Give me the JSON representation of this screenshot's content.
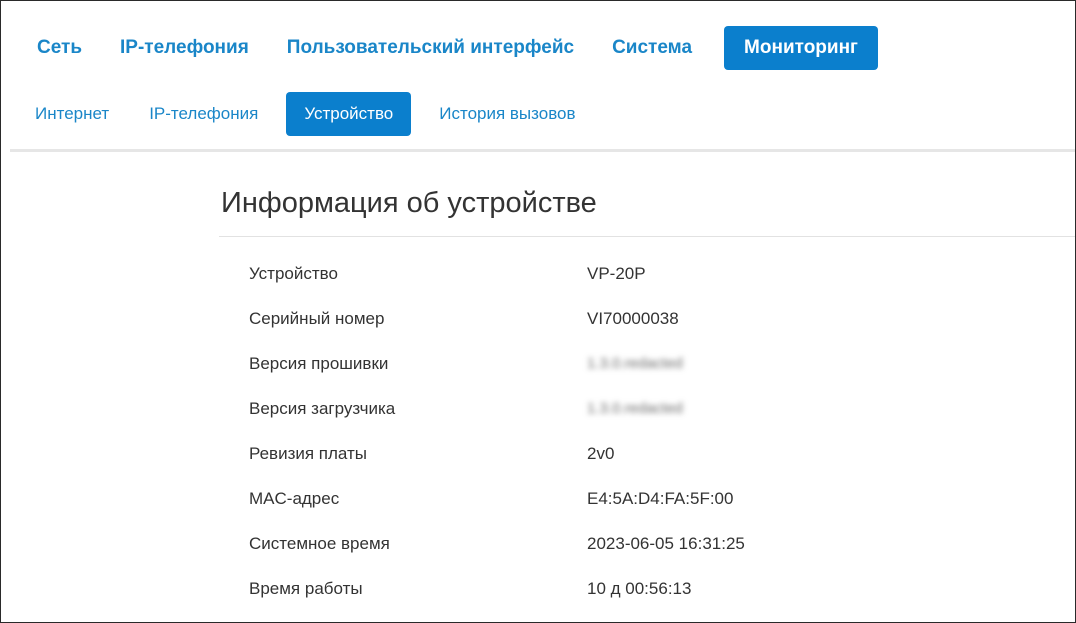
{
  "main_nav": {
    "items": [
      {
        "label": "Сеть"
      },
      {
        "label": "IP-телефония"
      },
      {
        "label": "Пользовательский интерфейс"
      },
      {
        "label": "Система"
      },
      {
        "label": "Мониторинг"
      }
    ],
    "active": "Мониторинг"
  },
  "sub_nav": {
    "items": [
      {
        "label": "Интернет"
      },
      {
        "label": "IP-телефония"
      },
      {
        "label": "Устройство"
      },
      {
        "label": "История вызовов"
      }
    ],
    "active": "Устройство"
  },
  "device_info": {
    "title": "Информация об устройстве",
    "rows": [
      {
        "label": "Устройство",
        "value": "VP-20P"
      },
      {
        "label": "Серийный номер",
        "value": "VI70000038"
      },
      {
        "label": "Версия прошивки",
        "value": "1.3.0.redacted",
        "blurred": true
      },
      {
        "label": "Версия загрузчика",
        "value": "1.3.0.redacted",
        "blurred": true
      },
      {
        "label": "Ревизия платы",
        "value": "2v0"
      },
      {
        "label": "MAC-адрес",
        "value": "E4:5A:D4:FA:5F:00"
      },
      {
        "label": "Системное время",
        "value": "2023-06-05 16:31:25"
      },
      {
        "label": "Время работы",
        "value": "10 д 00:56:13"
      }
    ]
  },
  "colors": {
    "accent": "#0b7fcd",
    "link": "#1a86c8",
    "text": "#333333"
  }
}
